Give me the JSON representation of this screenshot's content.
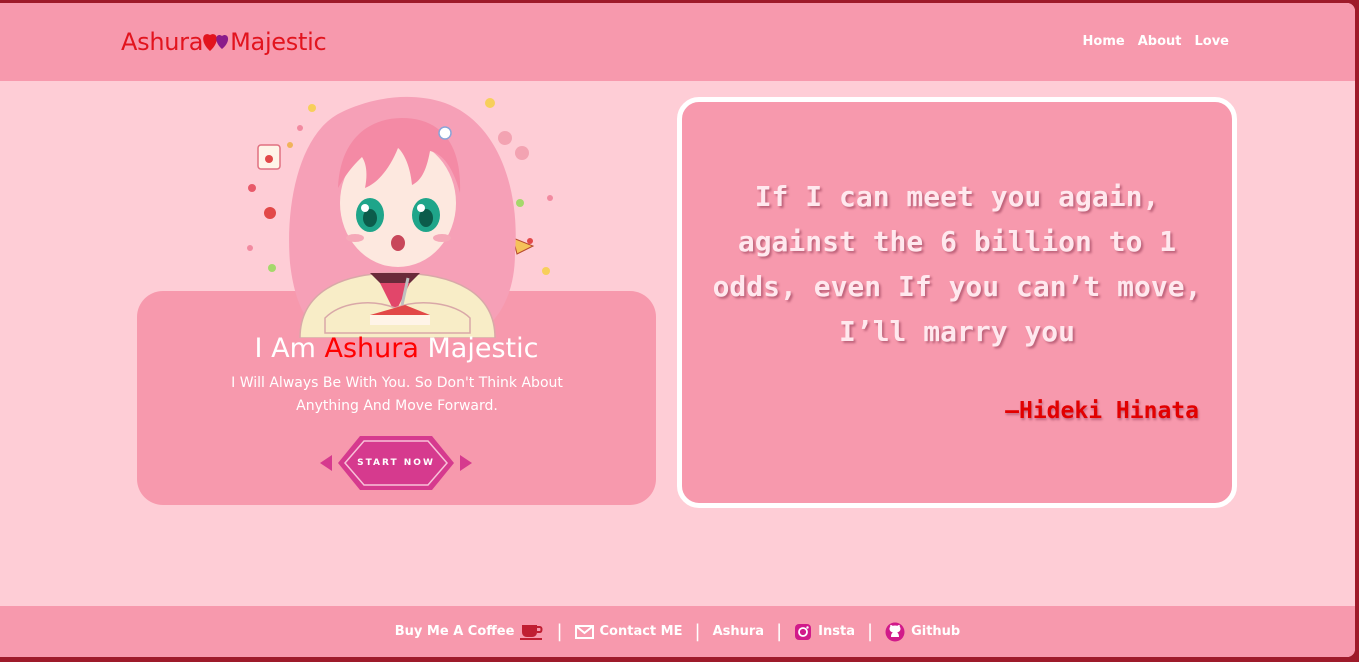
{
  "header": {
    "brand_first": "Ashura",
    "brand_second": "Majestic",
    "nav": [
      {
        "label": "Home"
      },
      {
        "label": "About"
      },
      {
        "label": "Love"
      }
    ]
  },
  "hero": {
    "title_prefix": "I Am",
    "title_name": "Ashura",
    "title_suffix": "Majestic",
    "subtitle": "I Will Always Be With You. So Don't Think About Anything And Move Forward.",
    "button_label": "START NOW"
  },
  "quote": {
    "text": "If I can meet you again, against the 6 billion to 1 odds, even If you can’t move, I’ll marry you",
    "author": "–Hideki Hinata"
  },
  "footer": {
    "links": [
      {
        "label": "Buy Me A Coffee",
        "icon": "coffee-icon"
      },
      {
        "label": "Contact ME",
        "icon": "mail-icon"
      },
      {
        "label": "Ashura",
        "icon": ""
      },
      {
        "label": "Insta",
        "icon": "instagram-icon"
      },
      {
        "label": "Github",
        "icon": "github-icon"
      }
    ],
    "separator": "|"
  },
  "colors": {
    "header_bg": "#f799ad",
    "page_bg": "#fecdd6",
    "accent_red": "#ff0000",
    "button_pink": "#d63a8e"
  }
}
